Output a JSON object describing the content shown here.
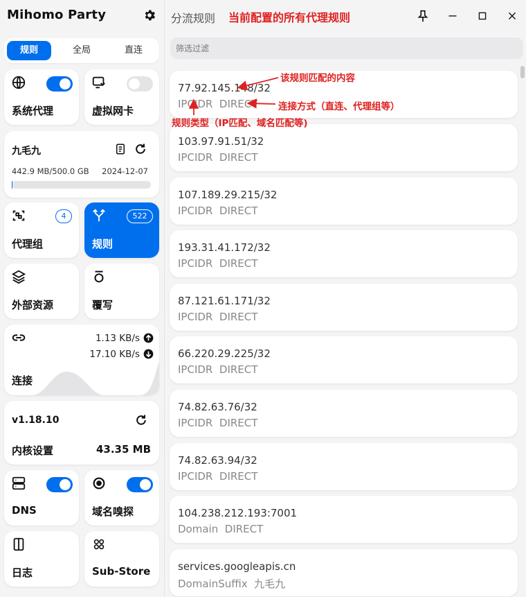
{
  "app": {
    "title": "Mihomo Party"
  },
  "mode_tabs": [
    {
      "label": "规则",
      "active": true
    },
    {
      "label": "全局",
      "active": false
    },
    {
      "label": "直连",
      "active": false
    }
  ],
  "sidebar": {
    "system_proxy": {
      "label": "系统代理",
      "enabled": true
    },
    "tun": {
      "label": "虚拟网卡",
      "enabled": false
    },
    "profile": {
      "name": "九毛九",
      "usage": "442.9 MB/500.0 GB",
      "expire": "2024-12-07",
      "progress": 0.001
    },
    "proxy_groups": {
      "label": "代理组",
      "count": "4"
    },
    "rules": {
      "label": "规则",
      "count": "522"
    },
    "resources": {
      "label": "外部资源"
    },
    "override": {
      "label": "覆写"
    },
    "connections": {
      "label": "连接",
      "upload": "1.13 KB/s",
      "download": "17.10 KB/s"
    },
    "core": {
      "version": "v1.18.10",
      "label": "内核设置",
      "memory": "43.35 MB"
    },
    "dns": {
      "label": "DNS",
      "enabled": true
    },
    "sniff": {
      "label": "域名嗅探",
      "enabled": true
    },
    "logs": {
      "label": "日志"
    },
    "substore": {
      "label": "Sub-Store"
    }
  },
  "main": {
    "title": "分流规则",
    "filter_placeholder": "筛选过滤",
    "rules": [
      {
        "payload": "77.92.145.148/32",
        "type": "IPCIDR",
        "proxy": "DIRECT"
      },
      {
        "payload": "103.97.91.51/32",
        "type": "IPCIDR",
        "proxy": "DIRECT"
      },
      {
        "payload": "107.189.29.215/32",
        "type": "IPCIDR",
        "proxy": "DIRECT"
      },
      {
        "payload": "193.31.41.172/32",
        "type": "IPCIDR",
        "proxy": "DIRECT"
      },
      {
        "payload": "87.121.61.171/32",
        "type": "IPCIDR",
        "proxy": "DIRECT"
      },
      {
        "payload": "66.220.29.225/32",
        "type": "IPCIDR",
        "proxy": "DIRECT"
      },
      {
        "payload": "74.82.63.76/32",
        "type": "IPCIDR",
        "proxy": "DIRECT"
      },
      {
        "payload": "74.82.63.94/32",
        "type": "IPCIDR",
        "proxy": "DIRECT"
      },
      {
        "payload": "104.238.212.193:7001",
        "type": "Domain",
        "proxy": "DIRECT"
      },
      {
        "payload": "services.googleapis.cn",
        "type": "DomainSuffix",
        "proxy": "九毛九"
      }
    ]
  },
  "annotations": {
    "title_note": "当前配置的所有代理规则",
    "payload_note": "该规则匹配的内容",
    "proxy_note": "连接方式（直连、代理组等）",
    "type_note": "规则类型（IP匹配、域名匹配等)"
  },
  "colors": {
    "accent": "#006fee",
    "annotation": "#e02020"
  }
}
